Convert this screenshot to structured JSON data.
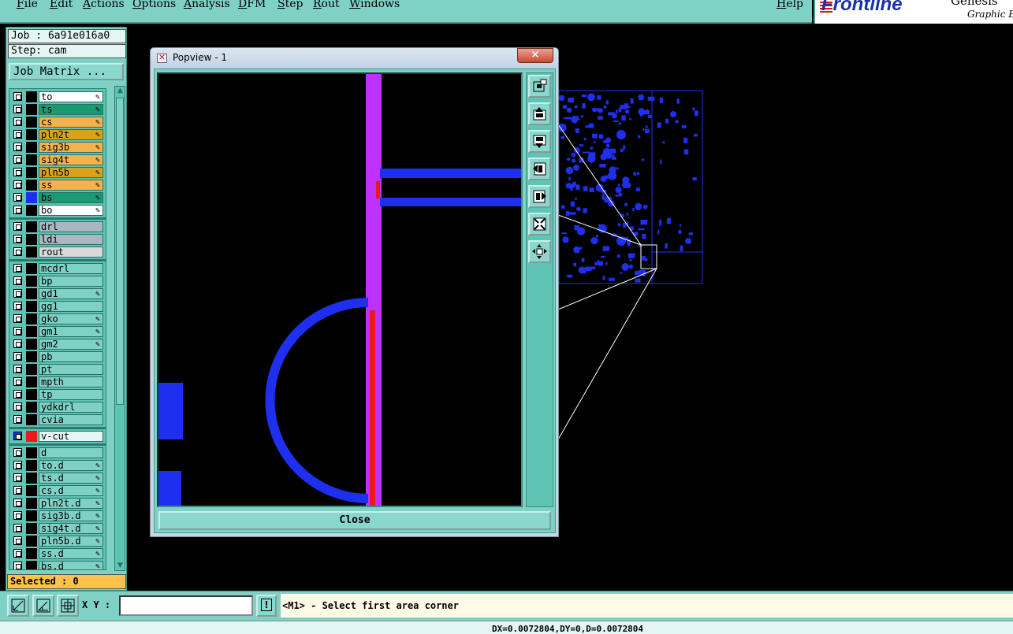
{
  "menubar": {
    "items": [
      "File",
      "Edit",
      "Actions",
      "Options",
      "Analysis",
      "DFM",
      "Step",
      "Rout",
      "Windows"
    ],
    "help": "Help"
  },
  "logo": {
    "brand": "Frontline",
    "product_line1": "Genesis",
    "product_line2": "Graphic E"
  },
  "job_panel": {
    "job": "Job : 6a91e016a0",
    "step": "Step: cam",
    "job_matrix_button": "Job Matrix ...",
    "selected": "Selected : 0"
  },
  "layers": [
    {
      "name": "to",
      "bg": "#ffffff",
      "swatch": "#000000",
      "editable": true
    },
    {
      "name": "ts",
      "bg": "#1a9a73",
      "swatch": "#000000",
      "editable": true
    },
    {
      "name": "cs",
      "bg": "#f5b24a",
      "swatch": "#000000",
      "editable": true
    },
    {
      "name": "pln2t",
      "bg": "#d9a21b",
      "swatch": "#000000",
      "editable": true
    },
    {
      "name": "sig3b",
      "bg": "#f5b24a",
      "swatch": "#000000",
      "editable": true
    },
    {
      "name": "sig4t",
      "bg": "#f5b24a",
      "swatch": "#000000",
      "editable": true
    },
    {
      "name": "pln5b",
      "bg": "#d9a21b",
      "swatch": "#000000",
      "editable": true
    },
    {
      "name": "ss",
      "bg": "#f5b24a",
      "swatch": "#000000",
      "editable": true
    },
    {
      "name": "bs",
      "bg": "#1a9a73",
      "swatch": "#1e2ff0",
      "editable": true
    },
    {
      "name": "bo",
      "bg": "#ffffff",
      "swatch": "#000000",
      "editable": true
    },
    {
      "sep": true
    },
    {
      "name": "drl",
      "bg": "#a9b8c0",
      "swatch": "#000000",
      "editable": false
    },
    {
      "name": "ldi",
      "bg": "#a9b8c0",
      "swatch": "#000000",
      "editable": false
    },
    {
      "name": "rout",
      "bg": "#d9d9d9",
      "swatch": "#000000",
      "editable": false
    },
    {
      "sep": true
    },
    {
      "name": "mcdrl",
      "bg": "#7fd1c6",
      "swatch": "#000000",
      "editable": false
    },
    {
      "name": "bp",
      "bg": "#7fd1c6",
      "swatch": "#000000",
      "editable": false
    },
    {
      "name": "gd1",
      "bg": "#7fd1c6",
      "swatch": "#000000",
      "editable": true
    },
    {
      "name": "gg1",
      "bg": "#7fd1c6",
      "swatch": "#000000",
      "editable": false
    },
    {
      "name": "gko",
      "bg": "#7fd1c6",
      "swatch": "#000000",
      "editable": true
    },
    {
      "name": "gm1",
      "bg": "#7fd1c6",
      "swatch": "#000000",
      "editable": true
    },
    {
      "name": "gm2",
      "bg": "#7fd1c6",
      "swatch": "#000000",
      "editable": true
    },
    {
      "name": "pb",
      "bg": "#7fd1c6",
      "swatch": "#000000",
      "editable": false
    },
    {
      "name": "pt",
      "bg": "#7fd1c6",
      "swatch": "#000000",
      "editable": false
    },
    {
      "name": "mpth",
      "bg": "#7fd1c6",
      "swatch": "#000000",
      "editable": false
    },
    {
      "name": "tp",
      "bg": "#7fd1c6",
      "swatch": "#000000",
      "editable": false
    },
    {
      "name": "ydkdrl",
      "bg": "#7fd1c6",
      "swatch": "#000000",
      "editable": false
    },
    {
      "name": "cvia",
      "bg": "#7fd1c6",
      "swatch": "#000000",
      "editable": false
    },
    {
      "sep": true
    },
    {
      "name": "v-cut",
      "bg": "#e4f6f2",
      "swatch": "#e81a1a",
      "editable": false,
      "checked": true
    },
    {
      "sep": true
    },
    {
      "name": "d",
      "bg": "#7fd1c6",
      "swatch": "#000000",
      "editable": false
    },
    {
      "name": "to.d",
      "bg": "#7fd1c6",
      "swatch": "#000000",
      "editable": true
    },
    {
      "name": "ts.d",
      "bg": "#7fd1c6",
      "swatch": "#000000",
      "editable": true
    },
    {
      "name": "cs.d",
      "bg": "#7fd1c6",
      "swatch": "#000000",
      "editable": true
    },
    {
      "name": "pln2t.d",
      "bg": "#7fd1c6",
      "swatch": "#000000",
      "editable": true
    },
    {
      "name": "sig3b.d",
      "bg": "#7fd1c6",
      "swatch": "#000000",
      "editable": true
    },
    {
      "name": "sig4t.d",
      "bg": "#7fd1c6",
      "swatch": "#000000",
      "editable": true
    },
    {
      "name": "pln5b.d",
      "bg": "#7fd1c6",
      "swatch": "#000000",
      "editable": true
    },
    {
      "name": "ss.d",
      "bg": "#7fd1c6",
      "swatch": "#000000",
      "editable": true
    },
    {
      "name": "bs.d",
      "bg": "#7fd1c6",
      "swatch": "#000000",
      "editable": true
    }
  ],
  "popview": {
    "title": "Popview - 1",
    "close_x": "×",
    "close_button": "Close",
    "tools": [
      "zoom-home-icon",
      "zoom-in-icon",
      "zoom-out-icon",
      "pan-left-icon",
      "pan-right-icon",
      "fit-all-icon",
      "center-icon"
    ]
  },
  "bottombar": {
    "xy_label": "X Y :",
    "xy_value": "",
    "bang": "!",
    "prompt": "<M1> - Select first area corner"
  },
  "status": {
    "text": "DX=0.0072804,DY=0,D=0.0072804"
  },
  "colors": {
    "panel": "#7fd1c6",
    "trace_blue": "#1e2ff0",
    "vcut_magenta": "#c030ff",
    "vcut_red": "#e81a1a"
  }
}
